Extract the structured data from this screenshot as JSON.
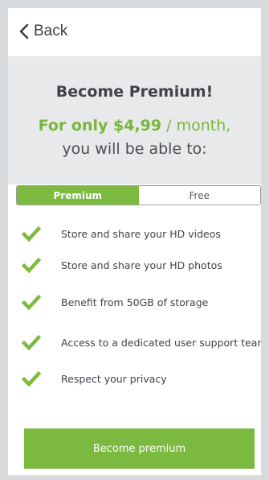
{
  "nav": {
    "back_label": "Back"
  },
  "hero": {
    "title": "Become Premium!",
    "price_prefix": "For only ",
    "price": "$4,99",
    "price_suffix": " / month,",
    "subtitle": "you will be able to:"
  },
  "plan_toggle": {
    "options": [
      "Premium",
      "Free"
    ],
    "selected": "Premium"
  },
  "features": [
    "Store and share your HD videos",
    "Store and share your HD photos",
    "Benefit from 50GB of storage",
    "Access to a dedicated user support team",
    "Respect your privacy"
  ],
  "cta": {
    "label": "Become premium"
  },
  "colors": {
    "accent": "#7cbb3f",
    "hero_background": "#e8e9ea",
    "page_background": "#d7dbde"
  },
  "icons": {
    "back": "chevron-left-icon",
    "feature": "check-icon"
  }
}
